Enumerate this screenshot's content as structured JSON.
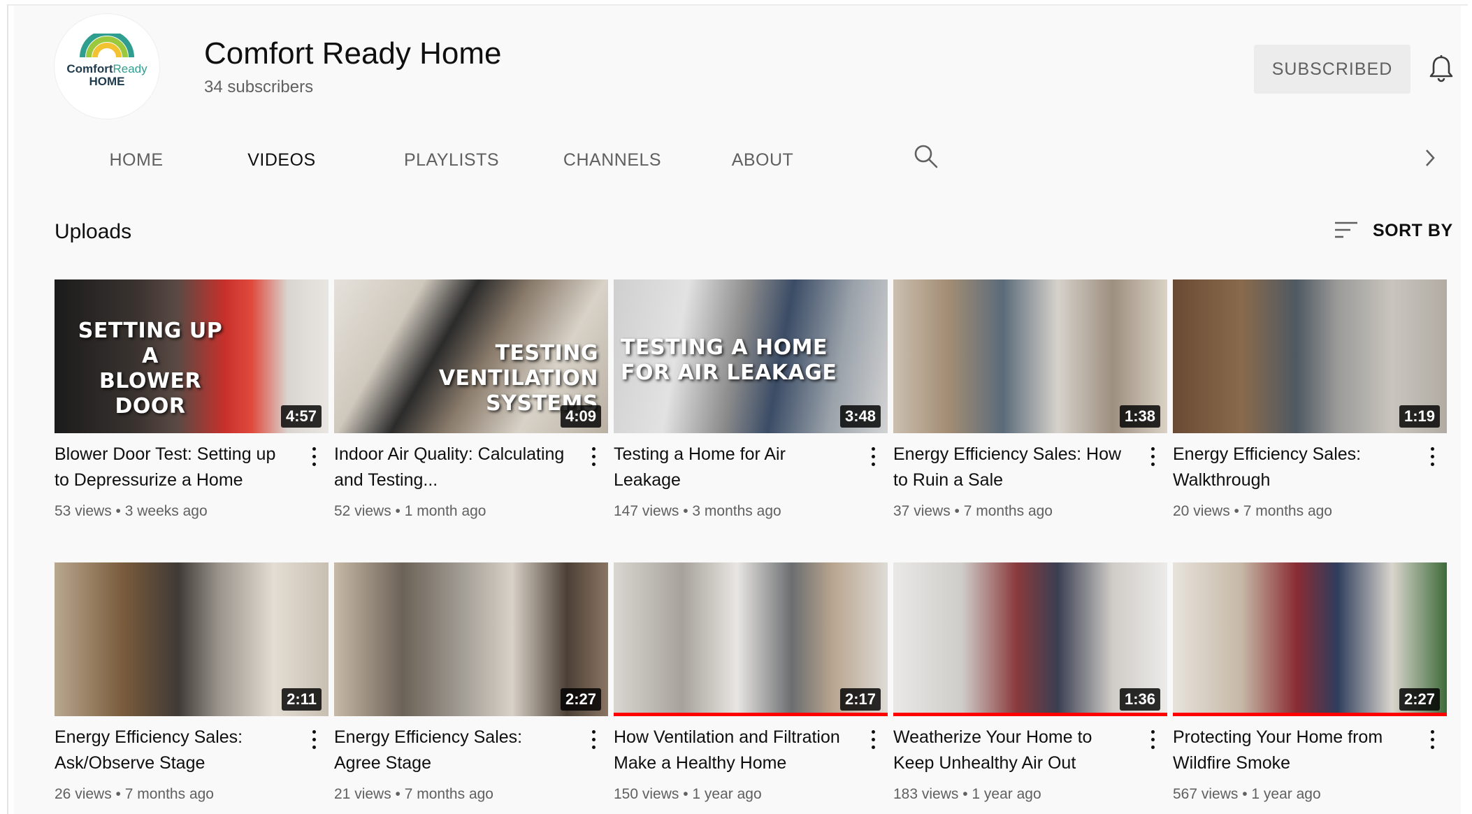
{
  "channel": {
    "logo": {
      "line1_a": "Comfort",
      "line1_b": "Ready",
      "line2": "HOME"
    },
    "name": "Comfort Ready Home",
    "subscribers": "34 subscribers",
    "subscribe_button": "SUBSCRIBED",
    "bell_icon": "bell-icon"
  },
  "tabs": [
    {
      "label": "HOME",
      "active": false
    },
    {
      "label": "VIDEOS",
      "active": true
    },
    {
      "label": "PLAYLISTS",
      "active": false
    },
    {
      "label": "CHANNELS",
      "active": false
    },
    {
      "label": "ABOUT",
      "active": false
    }
  ],
  "section": {
    "title": "Uploads",
    "sort_label": "SORT BY"
  },
  "colors": {
    "page_bg": "#f9f9f9",
    "text_primary": "#0f0f0f",
    "text_secondary": "#606060",
    "progress_red": "#ff0000",
    "logo_teal": "#2f9e8f",
    "logo_navy": "#1f3b4d"
  },
  "videos": [
    {
      "title": "Blower Door Test: Setting up to Depressurize a Home",
      "views": "53 views",
      "age": "3 weeks ago",
      "duration": "4:57",
      "thumb_text": [
        "SETTING UP",
        "A",
        "BLOWER DOOR"
      ],
      "watched": 0
    },
    {
      "title": "Indoor Air Quality: Calculating and Testing...",
      "views": "52 views",
      "age": "1 month ago",
      "duration": "4:09",
      "thumb_text": [
        "TESTING",
        "VENTILATION SYSTEMS"
      ],
      "watched": 0
    },
    {
      "title": "Testing a Home for Air Leakage",
      "views": "147 views",
      "age": "3 months ago",
      "duration": "3:48",
      "thumb_text": [
        "TESTING A HOME",
        "FOR AIR LEAKAGE"
      ],
      "watched": 0
    },
    {
      "title": "Energy Efficiency Sales: How to Ruin a Sale",
      "views": "37 views",
      "age": "7 months ago",
      "duration": "1:38",
      "thumb_text": [],
      "watched": 0
    },
    {
      "title": "Energy Efficiency Sales: Walkthrough",
      "views": "20 views",
      "age": "7 months ago",
      "duration": "1:19",
      "thumb_text": [],
      "watched": 0
    },
    {
      "title": "Energy Efficiency Sales: Ask/Observe Stage",
      "views": "26 views",
      "age": "7 months ago",
      "duration": "2:11",
      "thumb_text": [],
      "watched": 0
    },
    {
      "title": "Energy Efficiency Sales: Agree Stage",
      "views": "21 views",
      "age": "7 months ago",
      "duration": "2:27",
      "thumb_text": [],
      "watched": 0
    },
    {
      "title": "How Ventilation and Filtration Make a Healthy Home",
      "views": "150 views",
      "age": "1 year ago",
      "duration": "2:17",
      "thumb_text": [],
      "watched": 1.0
    },
    {
      "title": "Weatherize Your Home to Keep Unhealthy Air Out",
      "views": "183 views",
      "age": "1 year ago",
      "duration": "1:36",
      "thumb_text": [],
      "watched": 1.0
    },
    {
      "title": "Protecting Your Home from Wildfire Smoke",
      "views": "567 views",
      "age": "1 year ago",
      "duration": "2:27",
      "thumb_text": [],
      "watched": 1.0
    }
  ]
}
